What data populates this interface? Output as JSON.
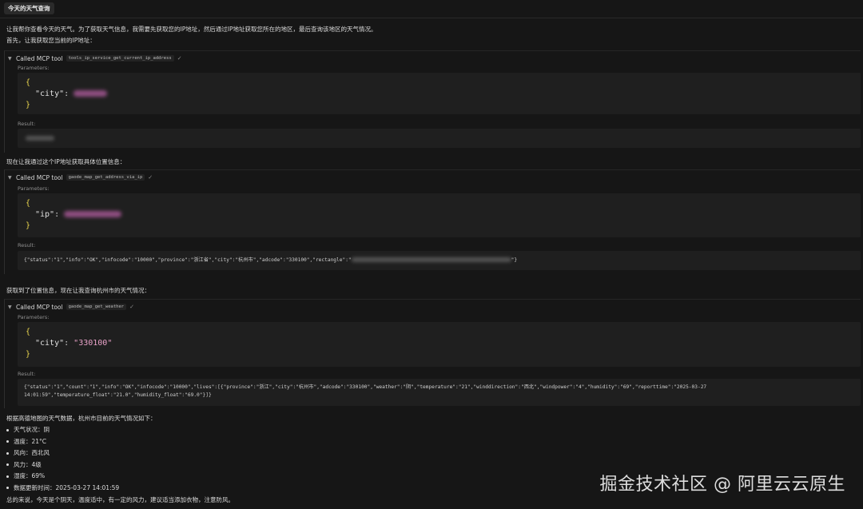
{
  "user_message": "今天的天气查询",
  "intro": {
    "line1": "让我帮你查看今天的天气。为了获取天气信息，我需要先获取您的IP地址，然后通过IP地址获取您所在的地区，最后查询该地区的天气情况。",
    "line2": "首先，让我获取您当前的IP地址："
  },
  "labels": {
    "called": "Called MCP tool",
    "parameters": "Parameters:",
    "result": "Result:"
  },
  "tool1": {
    "name": "tools_ip_service_get_current_ip_address",
    "param_key": "\"city\"",
    "param_value": ""
  },
  "msg2": "现在让我通过这个IP地址获取具体位置信息：",
  "tool2": {
    "name": "gaode_map_get_address_via_ip",
    "param_key": "\"ip\"",
    "result_prefix": "{\"status\":\"1\",\"info\":\"OK\",\"infocode\":\"10000\",\"province\":\"浙江省\",\"city\":\"杭州市\",\"adcode\":\"330100\",\"rectangle\":\"",
    "result_suffix": "\"}"
  },
  "msg3": "获取到了位置信息，现在让我查询杭州市的天气情况：",
  "tool3": {
    "name": "gaode_map_get_weather",
    "param_key": "\"city\"",
    "param_value": "\"330100\"",
    "result_line1": "{\"status\":\"1\",\"count\":\"1\",\"info\":\"OK\",\"infocode\":\"10000\",\"lives\":[{\"province\":\"浙江\",\"city\":\"杭州市\",\"adcode\":\"330100\",\"weather\":\"阴\",\"temperature\":\"21\",\"winddirection\":\"西北\",\"windpower\":\"4\",\"humidity\":\"69\",\"reporttime\":\"2025-03-27",
    "result_line2": "14:01:59\",\"temperature_float\":\"21.0\",\"humidity_float\":\"69.0\"}]}"
  },
  "summary": {
    "heading": "根据高德地图的天气数据，杭州市目前的天气情况如下：",
    "items": [
      "天气状况：阴",
      "温度：21°C",
      "风向：西北风",
      "风力：4级",
      "湿度：69%",
      "数据更新时间：2025-03-27 14:01:59"
    ],
    "closing": "总的来说，今天是个阴天，温度适中，有一定的风力，建议适当添加衣物，注意防风。"
  },
  "watermark": "掘金技术社区 @ 阿里云云原生"
}
